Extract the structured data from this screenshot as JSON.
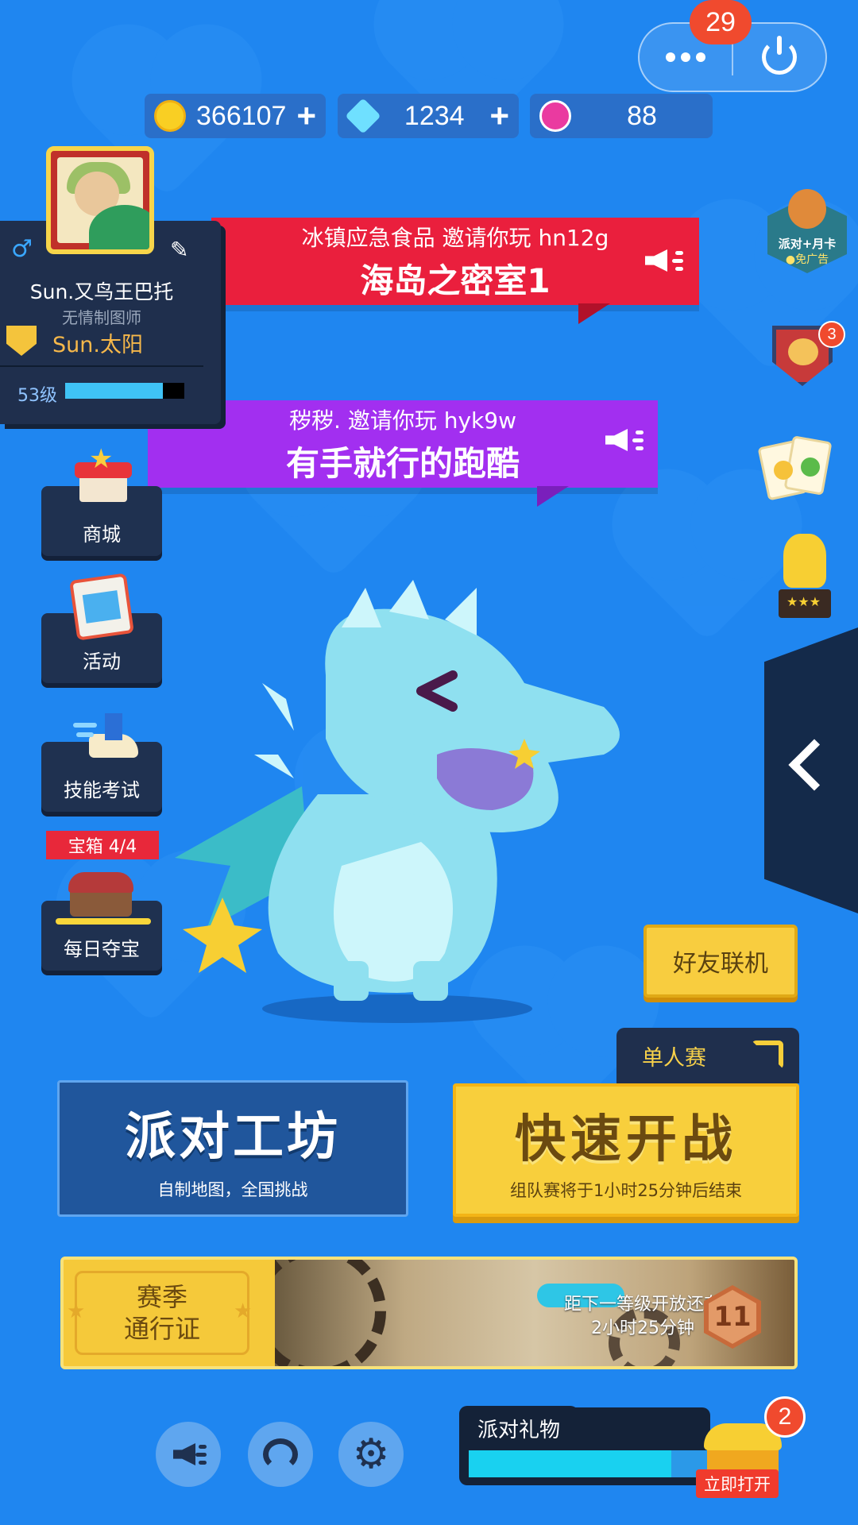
{
  "capsule": {
    "badge_count": "29"
  },
  "currency": {
    "coins": "366107",
    "gems": "1234",
    "lotus": "88"
  },
  "profile": {
    "name": "Sun.又鸟王巴托",
    "title": "无情制图师",
    "team": "Sun.太阳",
    "level": "53级",
    "level_progress": 0.82
  },
  "invites": [
    {
      "inviter": "冰镇应急食品 邀请你玩 hn12g",
      "map": "海岛之密室1",
      "color": "#ea1f3d"
    },
    {
      "inviter": "秽秽. 邀请你玩 hyk9w",
      "map": "有手就行的跑酷",
      "color": "#a22ff0"
    }
  ],
  "side_menu": [
    {
      "label": "商城"
    },
    {
      "label": "活动"
    },
    {
      "label": "技能考试"
    },
    {
      "label": "每日夺宝",
      "tag": "宝箱 4/4"
    }
  ],
  "right_icons": {
    "ad_label_1": "派对+月卡",
    "ad_label_2": "●免广告",
    "clan_badge": "3"
  },
  "buttons": {
    "friend": "好友联机",
    "single": "单人赛",
    "workshop_title": "派对工坊",
    "workshop_sub": "自制地图，全国挑战",
    "quick_title": "快速开战",
    "quick_sub": "组队赛将于1小时25分钟后结束"
  },
  "season": {
    "label_1": "赛季",
    "label_2": "通行证",
    "info_1": "距下一等级开放还有",
    "info_2": "2小时25分钟",
    "level": "11"
  },
  "gift": {
    "title": "派对礼物",
    "badge": "2",
    "open": "立即打开",
    "progress": 0.85
  },
  "colors": {
    "background": "#1f86f0",
    "yellow": "#f8cd3f",
    "navy": "#1f2f4d"
  }
}
